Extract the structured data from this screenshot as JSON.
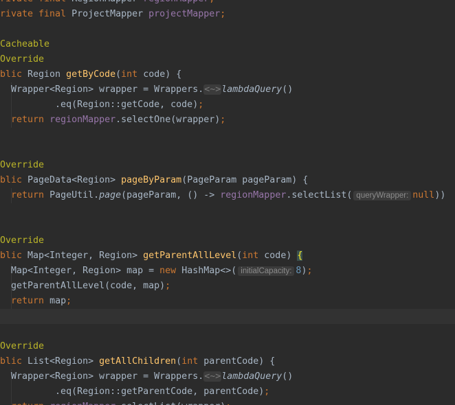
{
  "editor": {
    "language": "java",
    "theme": "darcula",
    "current_line": 21,
    "lines": [
      [
        {
          "t": "rivate final ",
          "c": "kw"
        },
        {
          "t": "RegionMapper ",
          "c": "id"
        },
        {
          "t": "regionMapper",
          "c": "fld"
        },
        {
          "t": ";",
          "c": "kw"
        }
      ],
      [
        {
          "t": "rivate final ",
          "c": "kw"
        },
        {
          "t": "ProjectMapper ",
          "c": "id"
        },
        {
          "t": "projectMapper",
          "c": "fld"
        },
        {
          "t": ";",
          "c": "kw"
        }
      ],
      [],
      [
        {
          "t": "Cacheable",
          "c": "ann"
        }
      ],
      [
        {
          "t": "Override",
          "c": "ann"
        }
      ],
      [
        {
          "t": "blic ",
          "c": "kw"
        },
        {
          "t": "Region ",
          "c": "id"
        },
        {
          "t": "getByCode",
          "c": "fn"
        },
        {
          "t": "(",
          "c": "id"
        },
        {
          "t": "int ",
          "c": "kw"
        },
        {
          "t": "code) {",
          "c": "id"
        }
      ],
      [
        {
          "t": "  Wrapper<Region> wrapper = Wrappers.",
          "c": "id"
        },
        {
          "t": "<~>",
          "c": "gen"
        },
        {
          "t": "lambdaQuery",
          "c": "id",
          "i": true
        },
        {
          "t": "()",
          "c": "id"
        }
      ],
      [
        {
          "t": "          .eq(Region::getCode, code)",
          "c": "id"
        },
        {
          "t": ";",
          "c": "kw"
        }
      ],
      [
        {
          "t": "  ",
          "c": "id"
        },
        {
          "t": "return ",
          "c": "kw"
        },
        {
          "t": "regionMapper",
          "c": "fld"
        },
        {
          "t": ".selectOne(wrapper)",
          "c": "id"
        },
        {
          "t": ";",
          "c": "kw"
        }
      ],
      [],
      [],
      [
        {
          "t": "Override",
          "c": "ann"
        }
      ],
      [
        {
          "t": "blic ",
          "c": "kw"
        },
        {
          "t": "PageData<Region> ",
          "c": "id"
        },
        {
          "t": "pageByParam",
          "c": "fn"
        },
        {
          "t": "(PageParam pageParam) {",
          "c": "id"
        }
      ],
      [
        {
          "t": "  ",
          "c": "id"
        },
        {
          "t": "return ",
          "c": "kw"
        },
        {
          "t": "PageUtil.",
          "c": "id"
        },
        {
          "t": "page",
          "c": "id",
          "i": true
        },
        {
          "t": "(pageParam, () -> ",
          "c": "id"
        },
        {
          "t": "regionMapper",
          "c": "fld"
        },
        {
          "t": ".selectList(",
          "c": "id"
        },
        {
          "t": "queryWrapper:",
          "c": "hint"
        },
        {
          "t": "null",
          "c": "kw"
        },
        {
          "t": "))",
          "c": "id"
        }
      ],
      [],
      [],
      [
        {
          "t": "Override",
          "c": "ann"
        }
      ],
      [
        {
          "t": "blic ",
          "c": "kw"
        },
        {
          "t": "Map<Integer, Region> ",
          "c": "id"
        },
        {
          "t": "getParentAllLevel",
          "c": "fn"
        },
        {
          "t": "(",
          "c": "id"
        },
        {
          "t": "int ",
          "c": "kw"
        },
        {
          "t": "code) ",
          "c": "id"
        },
        {
          "t": "{",
          "c": "bhl"
        }
      ],
      [
        {
          "t": "  Map<Integer, Region> map = ",
          "c": "id"
        },
        {
          "t": "new ",
          "c": "kw"
        },
        {
          "t": "HashMap<>(",
          "c": "id"
        },
        {
          "t": "initialCapacity:",
          "c": "hint"
        },
        {
          "t": "8",
          "c": "num"
        },
        {
          "t": ")",
          "c": "id"
        },
        {
          "t": ";",
          "c": "kw"
        }
      ],
      [
        {
          "t": "  getParentAllLevel(code, map)",
          "c": "id"
        },
        {
          "t": ";",
          "c": "kw"
        }
      ],
      [
        {
          "t": "  ",
          "c": "id"
        },
        {
          "t": "return ",
          "c": "kw"
        },
        {
          "t": "map",
          "c": "id"
        },
        {
          "t": ";",
          "c": "kw"
        }
      ],
      [],
      [],
      [
        {
          "t": "Override",
          "c": "ann"
        }
      ],
      [
        {
          "t": "blic ",
          "c": "kw"
        },
        {
          "t": "List<Region> ",
          "c": "id"
        },
        {
          "t": "getAllChildren",
          "c": "fn"
        },
        {
          "t": "(",
          "c": "id"
        },
        {
          "t": "int ",
          "c": "kw"
        },
        {
          "t": "parentCode) {",
          "c": "id"
        }
      ],
      [
        {
          "t": "  Wrapper<Region> wrapper = Wrappers.",
          "c": "id"
        },
        {
          "t": "<~>",
          "c": "gen"
        },
        {
          "t": "lambdaQuery",
          "c": "id",
          "i": true
        },
        {
          "t": "()",
          "c": "id"
        }
      ],
      [
        {
          "t": "          .eq(Region::getParentCode, parentCode)",
          "c": "id"
        },
        {
          "t": ";",
          "c": "kw"
        }
      ],
      [
        {
          "t": "  ",
          "c": "id"
        },
        {
          "t": "return ",
          "c": "kw"
        },
        {
          "t": "regionMapper",
          "c": "fld"
        },
        {
          "t": ".selectList(wrapper)",
          "c": "id"
        },
        {
          "t": ";",
          "c": "kw"
        }
      ]
    ],
    "colors": {
      "background": "#2b2b2b",
      "keyword": "#cc7832",
      "identifier": "#a9b7c6",
      "method_decl": "#ffc66d",
      "field": "#9876aa",
      "annotation": "#bbb529",
      "number": "#6897bb",
      "hint_text": "#8c8c8c",
      "current_line": "#323232"
    }
  }
}
